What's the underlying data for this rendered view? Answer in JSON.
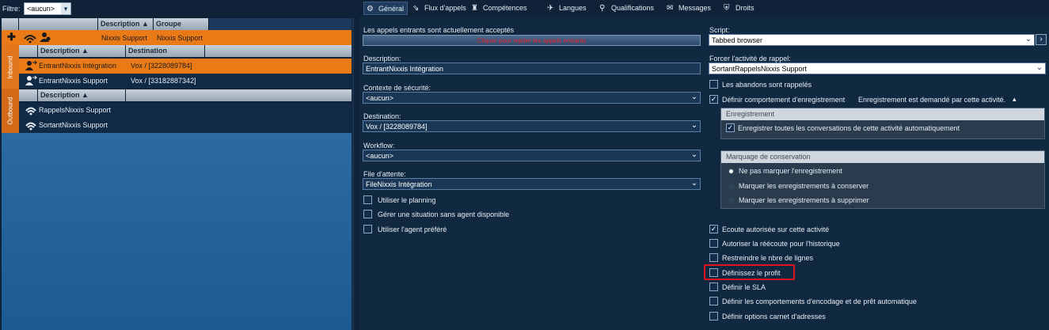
{
  "filter": {
    "label": "Filtre:",
    "value": "<aucun>"
  },
  "groups_header": {
    "description": "Description",
    "groupe": "Groupe"
  },
  "group_row": {
    "description": "Nixxis Support",
    "groupe": "Nixxis Support"
  },
  "side_tabs": {
    "inbound": "Inbound",
    "outbound": "Outbound"
  },
  "inbound": {
    "columns": {
      "description": "Description",
      "destination": "Destination"
    },
    "rows": [
      {
        "description": "EntrantNixxis Intégration",
        "destination": "Vox / [3228089784]"
      },
      {
        "description": "EntrantNixxis Support",
        "destination": "Vox / [33182887342]"
      }
    ]
  },
  "outbound": {
    "columns": {
      "description": "Description"
    },
    "rows": [
      {
        "description": "RappelsNixxis Support"
      },
      {
        "description": "SortantNixxis Support"
      }
    ]
  },
  "tabs": [
    {
      "label": "Général",
      "icon": "gear-icon"
    },
    {
      "label": "Flux d'appels",
      "icon": "flow-icon"
    },
    {
      "label": "Compétences",
      "icon": "skills-icon"
    },
    {
      "label": "Langues",
      "icon": "languages-icon"
    },
    {
      "label": "Qualifications",
      "icon": "search-icon"
    },
    {
      "label": "Messages",
      "icon": "messages-icon"
    },
    {
      "label": "Droits",
      "icon": "shield-icon"
    }
  ],
  "general": {
    "incoming_status": "Les appels entrants sont actuellement acceptés",
    "reject_button": "Cliquer pour rejeter les appels entrants",
    "description_label": "Description:",
    "description_value": "EntrantNixxis Intégration",
    "security_label": "Contexte de sécurité:",
    "security_value": "<aucun>",
    "destination_label": "Destination:",
    "destination_value": "Vox / [3228089784]",
    "workflow_label": "Workflow:",
    "workflow_value": "<aucun>",
    "queue_label": "File d'attente:",
    "queue_value": "FileNixxis Intégration",
    "use_planning": "Utiliser le planning",
    "no_agent": "Gérer une situation sans agent disponible",
    "preferred_agent": "Utiliser l'agent préféré",
    "script_label": "Script:",
    "script_value": "Tabbed browser",
    "callback_label": "Forcer l'activité de rappel:",
    "callback_value": "SortantRappelsNixxis Support",
    "abandons": "Les abandons sont rappelés",
    "record_behavior": "Définir comportement d'enregistrement",
    "record_behavior_note": "Enregistrement est demandé par cette activité.",
    "recording_group_title": "Enregistrement",
    "record_all": "Enregistrer toutes les conversations de cette activité automatiquement",
    "retention_group_title": "Marquage de conservation",
    "retention_options": [
      "Ne pas marquer l'enregistrement",
      "Marquer les enregistrements à conserver",
      "Marquer les enregistrements à supprimer"
    ],
    "listening_allowed": "Ecoute autorisée sur cette activité",
    "relisten_history": "Autoriser la réécoute pour l'historique",
    "restrict_lines": "Restreindre le nbre de lignes",
    "define_profit": "Définissez le profit",
    "define_sla": "Définir le SLA",
    "encoding_behavior": "Définir les comportements d'encodage et de prêt automatique",
    "address_book": "Définir options carnet d'adresses"
  },
  "colors": {
    "accent_orange": "#ea7a16",
    "highlight_red": "#e0141e",
    "reject_text": "#e82432",
    "panel_bg": "#112841"
  }
}
